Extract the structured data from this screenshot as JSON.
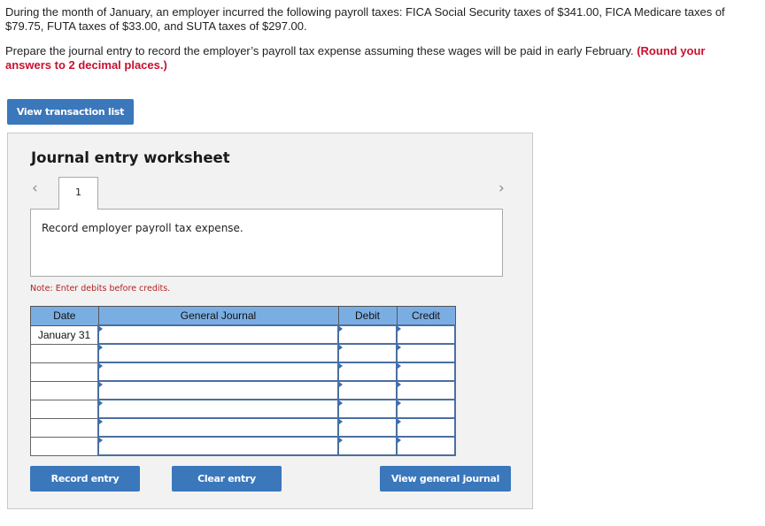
{
  "question": {
    "paragraph1": "During the month of January, an employer incurred the following payroll taxes: FICA Social Security taxes of $341.00, FICA Medicare taxes of $79.75, FUTA taxes of $33.00, and SUTA taxes of $297.00.",
    "paragraph2": "Prepare the journal entry to record the employer’s payroll tax expense assuming these wages will be paid in early February.",
    "instruction": "(Round your answers to 2 decimal places.)"
  },
  "buttons": {
    "view_transaction_list": "View transaction list",
    "record_entry": "Record entry",
    "clear_entry": "Clear entry",
    "view_general_journal": "View general journal"
  },
  "worksheet": {
    "title": "Journal entry worksheet",
    "prev_icon": "‹",
    "next_icon": "›",
    "tabs": [
      "1"
    ],
    "description": "Record employer payroll tax expense.",
    "note": "Note: Enter debits before credits."
  },
  "journal": {
    "headers": [
      "Date",
      "General Journal",
      "Debit",
      "Credit"
    ],
    "rows": [
      {
        "date": "January 31",
        "account": "",
        "debit": "",
        "credit": ""
      },
      {
        "date": "",
        "account": "",
        "debit": "",
        "credit": ""
      },
      {
        "date": "",
        "account": "",
        "debit": "",
        "credit": ""
      },
      {
        "date": "",
        "account": "",
        "debit": "",
        "credit": ""
      },
      {
        "date": "",
        "account": "",
        "debit": "",
        "credit": ""
      },
      {
        "date": "",
        "account": "",
        "debit": "",
        "credit": ""
      },
      {
        "date": "",
        "account": "",
        "debit": "",
        "credit": ""
      }
    ]
  },
  "colors": {
    "button_bg": "#3a77bb",
    "header_bg": "#7aaee3",
    "emphasis_red": "#c8102e",
    "panel_bg": "#f2f2f2"
  }
}
